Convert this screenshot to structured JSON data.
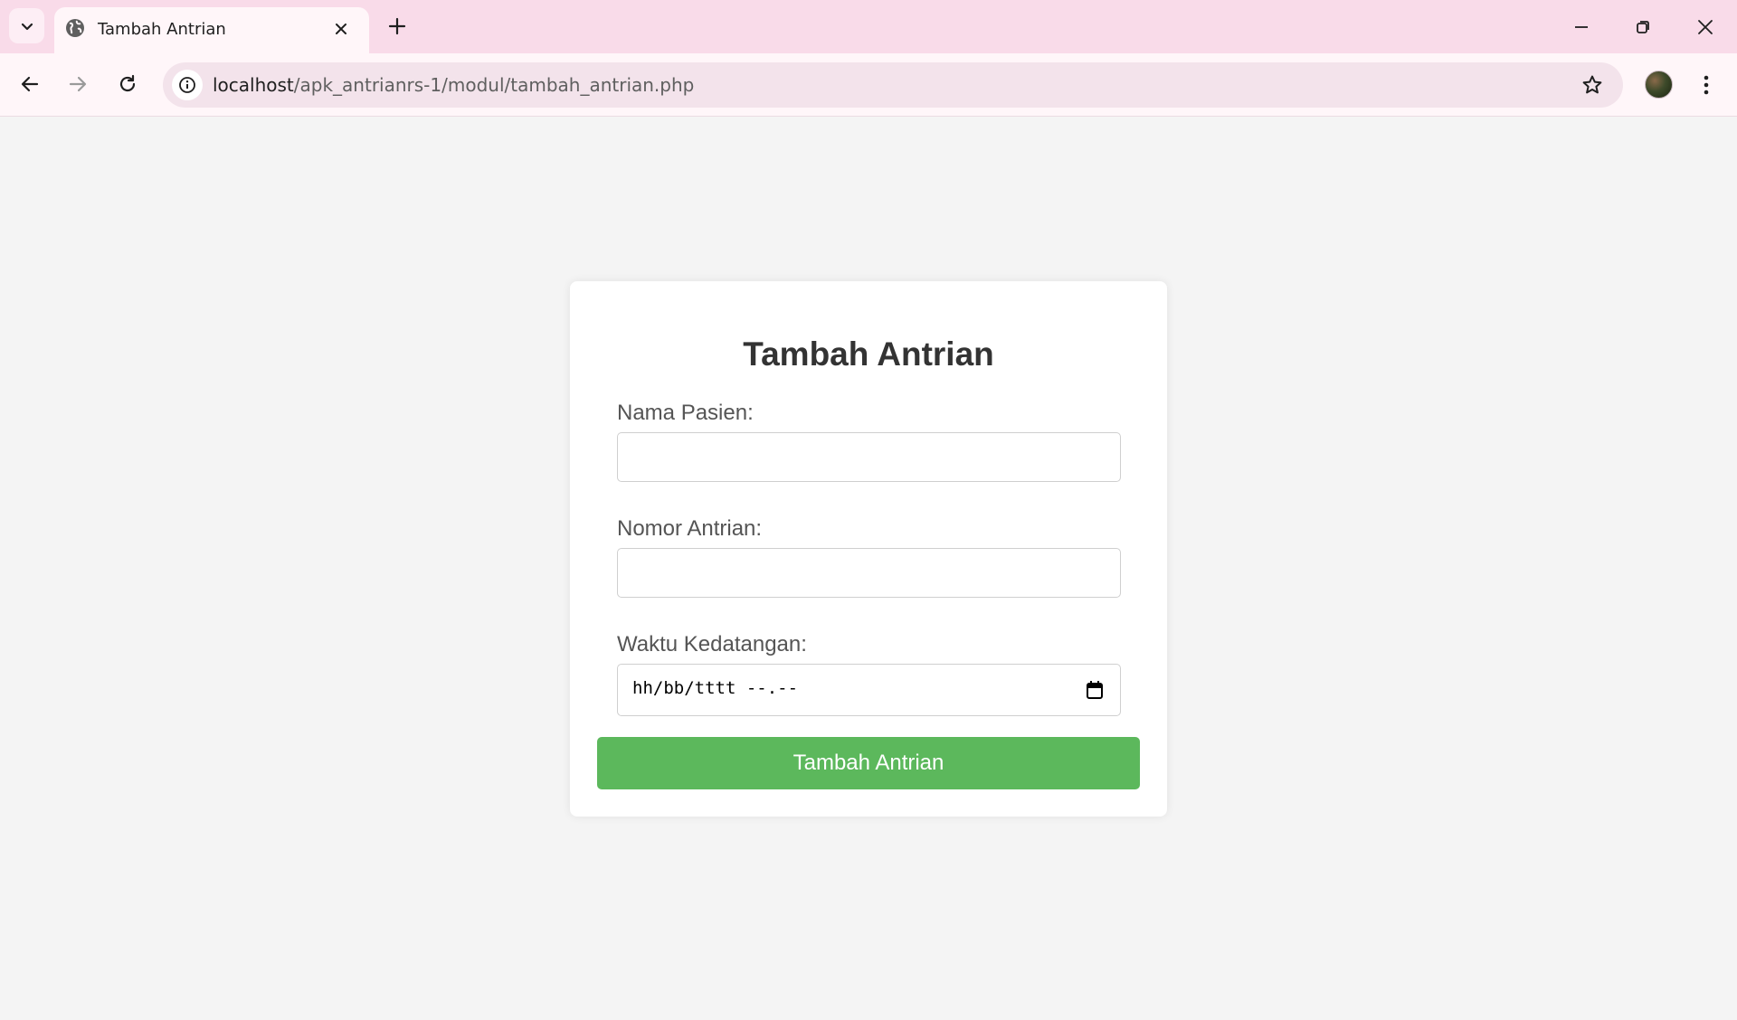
{
  "browser": {
    "tab_title": "Tambah Antrian",
    "url_host": "localhost",
    "url_path": "/apk_antrianrs-1/modul/tambah_antrian.php",
    "icons": [
      "tab-list-icon",
      "globe-icon",
      "close-icon",
      "plus-icon",
      "minimize-icon",
      "restore-icon",
      "window-close-icon",
      "back-arrow-icon",
      "forward-arrow-icon",
      "reload-icon",
      "info-icon",
      "star-icon",
      "profile-avatar",
      "more-vert-icon"
    ]
  },
  "form": {
    "title": "Tambah Antrian",
    "fields": [
      {
        "label": "Nama Pasien:",
        "value": "",
        "placeholder": ""
      },
      {
        "label": "Nomor Antrian:",
        "value": "",
        "placeholder": ""
      },
      {
        "label": "Waktu Kedatangan:",
        "display": "hh/bb/tttt --.--"
      }
    ],
    "submit_label": "Tambah Antrian"
  },
  "colors": {
    "tabstrip_bg": "#f9dbe9",
    "toolbar_bg": "#fff6f9",
    "page_bg": "#f4f4f4",
    "button_green": "#5cb85c"
  }
}
